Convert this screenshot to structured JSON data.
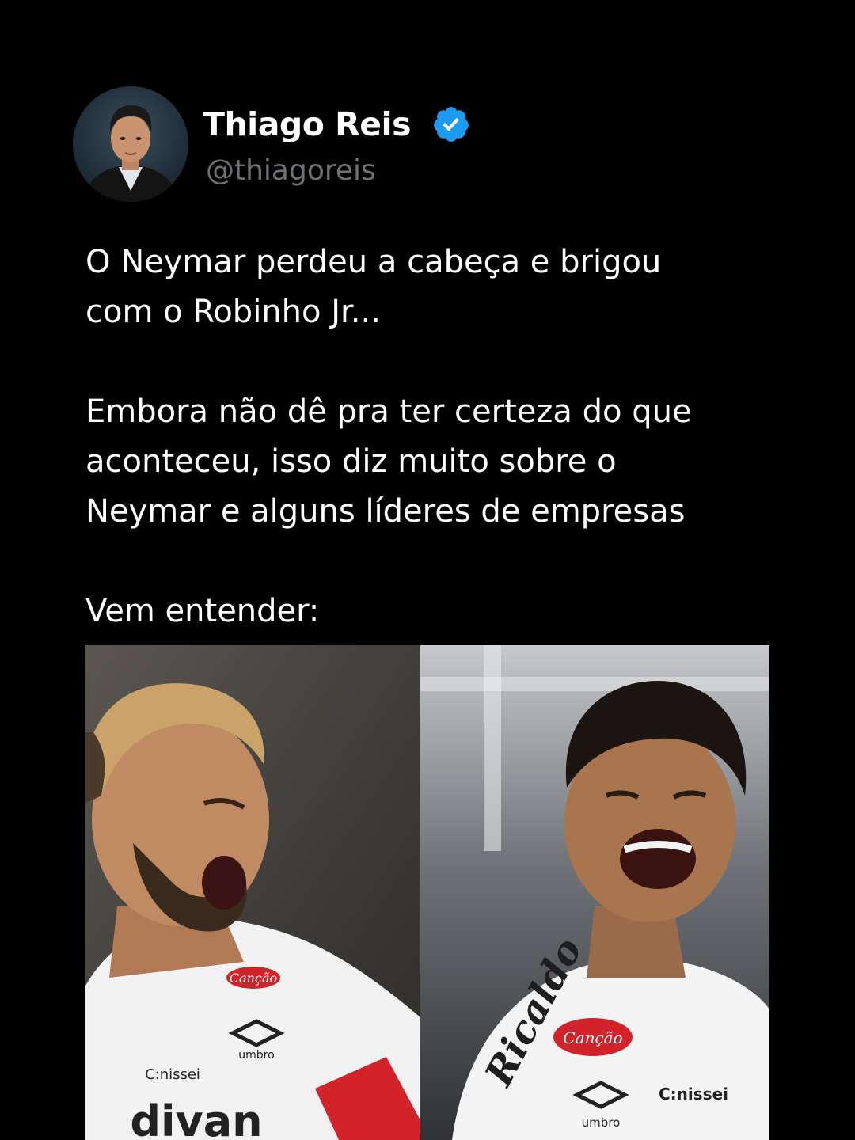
{
  "author": {
    "display_name": "Thiago Reis",
    "handle": "@thiagoreis",
    "verified_icon": "verified-badge-icon",
    "avatar_icon": "avatar-photo"
  },
  "post": {
    "paragraphs": [
      "O Neymar perdeu a cabeça e brigou\ncom o Robinho Jr...",
      "Embora não dê pra ter certeza do que\naconteceu, isso diz muito sobre o\nNeymar e alguns líderes de empresas",
      "Vem entender:"
    ]
  },
  "media": {
    "left_photo_icon": "player-photo-left",
    "right_photo_icon": "player-photo-right",
    "left_jersey_text": [
      "Canção",
      "umbro",
      "C:nissei",
      "divan"
    ],
    "right_jersey_text": [
      "Ricaldo",
      "Canção",
      "umbro",
      "C:nissei"
    ]
  },
  "colors": {
    "background": "#000000",
    "text": "#ffffff",
    "handle": "#6f7275",
    "verified": "#1d9bf0",
    "sponsor_red": "#d2232a"
  }
}
